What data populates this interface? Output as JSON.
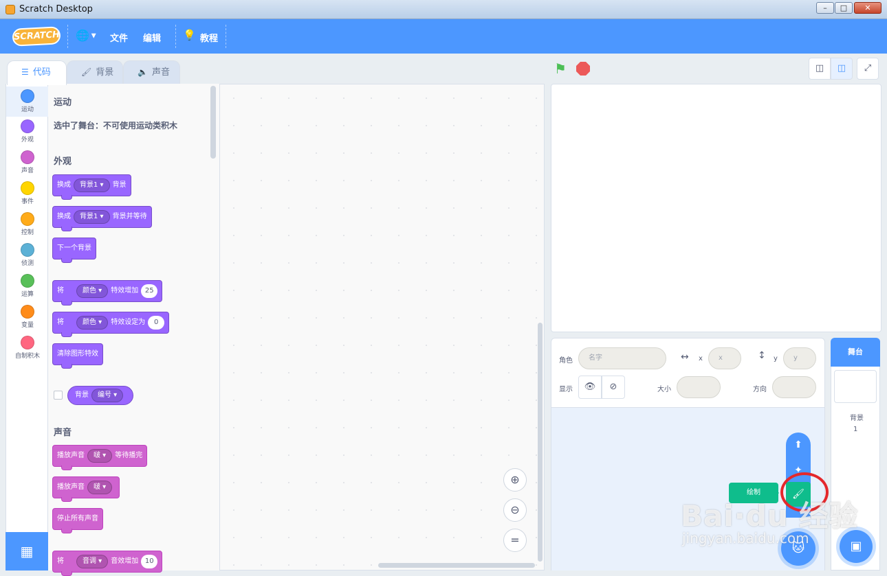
{
  "window": {
    "title": "Scratch Desktop",
    "min": "–",
    "max": "□",
    "close": "✕"
  },
  "menu": {
    "logo": "SCRATCH",
    "file": "文件",
    "edit": "编辑",
    "tutorials": "教程"
  },
  "tabs": [
    {
      "label": "代码"
    },
    {
      "label": "背景"
    },
    {
      "label": "声音"
    }
  ],
  "categories": [
    {
      "label": "运动",
      "color": "#4c97ff"
    },
    {
      "label": "外观",
      "color": "#9966ff"
    },
    {
      "label": "声音",
      "color": "#cf63cf"
    },
    {
      "label": "事件",
      "color": "#ffd500"
    },
    {
      "label": "控制",
      "color": "#ffab19"
    },
    {
      "label": "侦测",
      "color": "#5cb1d6"
    },
    {
      "label": "运算",
      "color": "#59c059"
    },
    {
      "label": "变量",
      "color": "#ff8c1a"
    },
    {
      "label": "自制积木",
      "color": "#ff6680"
    }
  ],
  "palette": {
    "motion_header": "运动",
    "motion_note": "选中了舞台：不可使用运动类积木",
    "looks_header": "外观",
    "sound_header": "声音",
    "blocks": {
      "b1": {
        "a": "换成",
        "d": "背景1",
        "b": "背景"
      },
      "b2": {
        "a": "换成",
        "d": "背景1",
        "b": "背景并等待"
      },
      "b3": {
        "a": "下一个背景"
      },
      "b4": {
        "a": "将",
        "d": "颜色",
        "b": "特效增加",
        "n": "25"
      },
      "b5": {
        "a": "将",
        "d": "颜色",
        "b": "特效设定为",
        "n": "0"
      },
      "b6": {
        "a": "清除图形特效"
      },
      "r1": {
        "a": "背景",
        "d": "编号"
      },
      "s1": {
        "a": "播放声音",
        "d": "啵",
        "b": "等待播完"
      },
      "s2": {
        "a": "播放声音",
        "d": "啵"
      },
      "s3": {
        "a": "停止所有声音"
      },
      "s4": {
        "a": "将",
        "d": "音调",
        "b": "音效增加",
        "n": "10"
      }
    }
  },
  "sprite_info": {
    "sprite_label": "角色",
    "name_placeholder": "名字",
    "x_label": "x",
    "x_placeholder": "x",
    "y_label": "y",
    "y_placeholder": "y",
    "show_label": "显示",
    "size_label": "大小",
    "direction_label": "方向"
  },
  "chooser": {
    "paint_tooltip": "绘制"
  },
  "stage_target": {
    "title": "舞台",
    "backdrops_label": "背景",
    "backdrops_count": "1"
  },
  "watermark": {
    "brand": "Bai·du 经验",
    "url": "jingyan.baidu.com"
  }
}
